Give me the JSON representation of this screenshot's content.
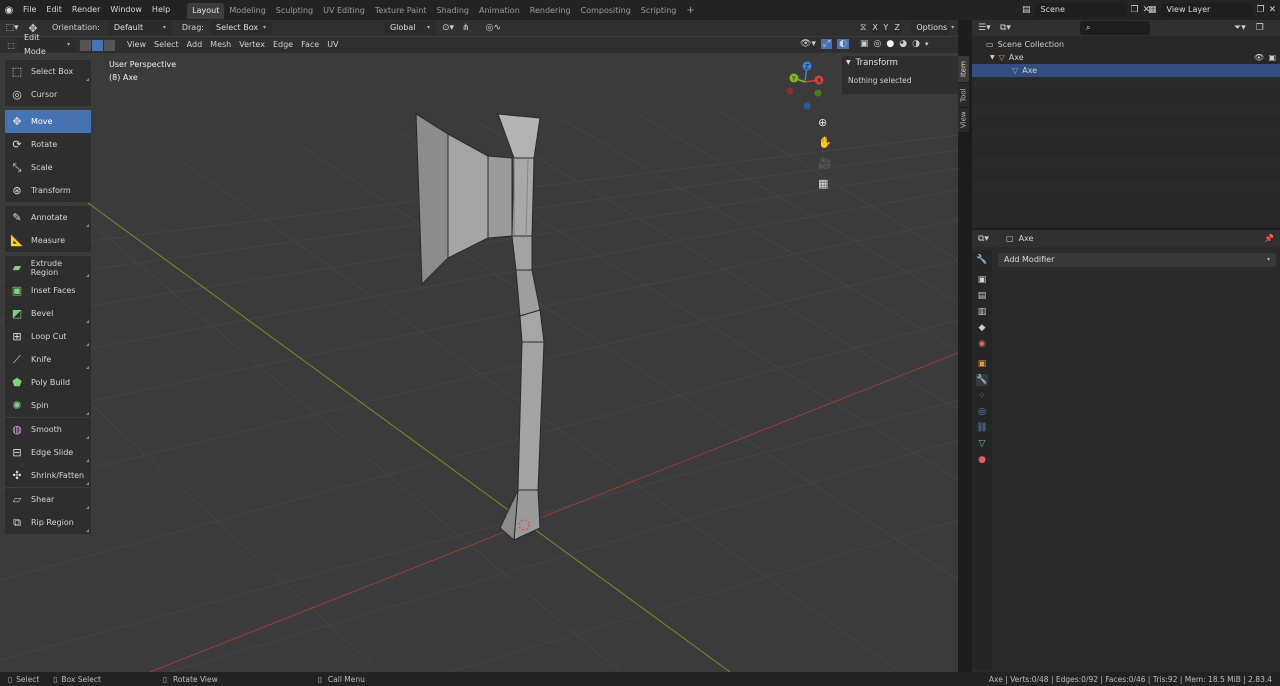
{
  "menubar": {
    "items": [
      "File",
      "Edit",
      "Render",
      "Window",
      "Help"
    ],
    "workspaces": [
      "Layout",
      "Modeling",
      "Sculpting",
      "UV Editing",
      "Texture Paint",
      "Shading",
      "Animation",
      "Rendering",
      "Compositing",
      "Scripting"
    ],
    "active_workspace": "Layout",
    "add_tab": "+",
    "scene_label": "Scene",
    "view_layer_label": "View Layer"
  },
  "tool_header": {
    "orientation_label": "Orientation:",
    "orientation_value": "Default",
    "drag_label": "Drag:",
    "drag_value": "Select Box",
    "transform_orientation": "Global",
    "axis_letters": [
      "X",
      "Y",
      "Z"
    ],
    "options_label": "Options"
  },
  "view_header": {
    "mode": "Edit Mode",
    "menus": [
      "View",
      "Select",
      "Add",
      "Mesh",
      "Vertex",
      "Edge",
      "Face",
      "UV"
    ]
  },
  "viewport": {
    "perspective_label": "User Perspective",
    "object_label": "(8) Axe",
    "gizmo_axes": [
      "Z",
      "Y",
      "X"
    ]
  },
  "toolbar": {
    "tools": [
      "Select Box",
      "Cursor",
      "Move",
      "Rotate",
      "Scale",
      "Transform",
      "Annotate",
      "Measure",
      "Extrude Region",
      "Inset Faces",
      "Bevel",
      "Loop Cut",
      "Knife",
      "Poly Build",
      "Spin",
      "Smooth",
      "Edge Slide",
      "Shrink/Fatten",
      "Shear",
      "Rip Region"
    ],
    "active": "Move",
    "icons": [
      "select-box-icon",
      "cursor-icon",
      "move-icon",
      "rotate-icon",
      "scale-icon",
      "transform-icon",
      "annotate-icon",
      "measure-icon",
      "extrude-icon",
      "inset-icon",
      "bevel-icon",
      "loop-cut-icon",
      "knife-icon",
      "poly-build-icon",
      "spin-icon",
      "smooth-icon",
      "edge-slide-icon",
      "shrink-fatten-icon",
      "shear-icon",
      "rip-region-icon"
    ]
  },
  "sidebar": {
    "panel_title": "Transform",
    "panel_text": "Nothing selected",
    "tabs": [
      "Item",
      "Tool",
      "View"
    ]
  },
  "outliner": {
    "root": "Scene Collection",
    "object": "Axe",
    "mesh": "Axe"
  },
  "properties": {
    "object_name": "Axe",
    "add_modifier": "Add Modifier"
  },
  "statusbar": {
    "left": [
      "Select",
      "Box Select",
      "Rotate View",
      "Call Menu"
    ],
    "stats": "Axe | Verts:0/48 | Edges:0/92 | Faces:0/46 | Tris:92 | Mem: 18.5 MiB | 2.83.4"
  },
  "colors": {
    "accent": "#4772b3",
    "viewport_bg": "#3b3b3b",
    "x_axis": "#d0423f",
    "y_axis": "#86b51e",
    "z_axis": "#3d82e0"
  }
}
